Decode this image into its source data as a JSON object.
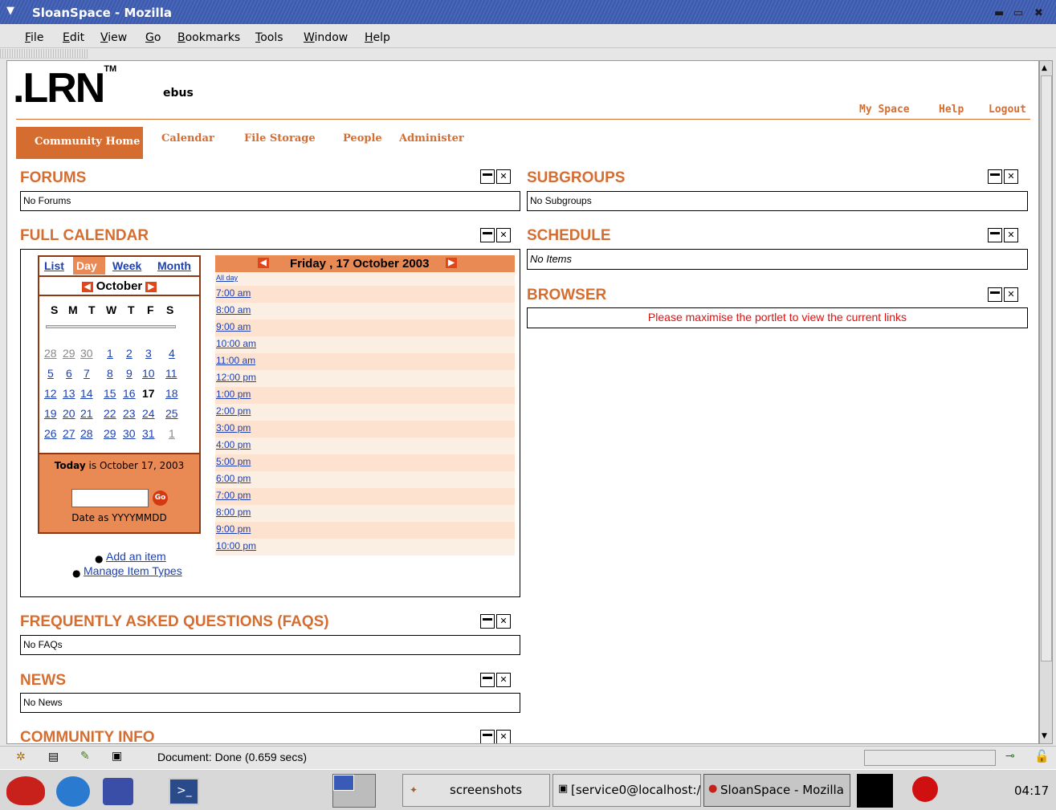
{
  "window": {
    "title": "SloanSpace - Mozilla"
  },
  "menu": [
    "File",
    "Edit",
    "View",
    "Go",
    "Bookmarks",
    "Tools",
    "Window",
    "Help"
  ],
  "header": {
    "logo": ".LRN",
    "tm": "TM",
    "community": "ebus",
    "links": [
      "My Space",
      "Help",
      "Logout"
    ]
  },
  "tabs": [
    "Community Home",
    "Calendar",
    "File Storage",
    "People",
    "Administer"
  ],
  "portlets": {
    "forums": {
      "title": "FORUMS",
      "body": "No Forums"
    },
    "subgroups": {
      "title": "SUBGROUPS",
      "body": "No Subgroups"
    },
    "full_calendar": {
      "title": "FULL CALENDAR"
    },
    "schedule": {
      "title": "SCHEDULE",
      "body": "No Items"
    },
    "browser": {
      "title": "BROWSER",
      "body": "Please maximise the portlet to view the current links"
    },
    "faqs": {
      "title": "FREQUENTLY ASKED QUESTIONS (FAQS)",
      "body": "No FAQs"
    },
    "news": {
      "title": "NEWS",
      "body": "No News"
    },
    "community_info": {
      "title": "COMMUNITY INFO"
    }
  },
  "calendar": {
    "views": [
      "List",
      "Day",
      "Week",
      "Month"
    ],
    "month": "October",
    "weekdays": [
      "S",
      "M",
      "T",
      "W",
      "T",
      "F",
      "S"
    ],
    "weeks": [
      [
        "28",
        "29",
        "30",
        "1",
        "2",
        "3",
        "4"
      ],
      [
        "5",
        "6",
        "7",
        "8",
        "9",
        "10",
        "11"
      ],
      [
        "12",
        "13",
        "14",
        "15",
        "16",
        "17",
        "18"
      ],
      [
        "19",
        "20",
        "21",
        "22",
        "23",
        "24",
        "25"
      ],
      [
        "26",
        "27",
        "28",
        "29",
        "30",
        "31",
        "1"
      ]
    ],
    "today_bold": "Today",
    "today_rest": " is October 17, 2003",
    "date_hint": "Date as YYYYMMDD",
    "go": "Go",
    "actions": [
      "Add an item",
      "Manage Item Types"
    ],
    "day_title": "Friday , 17 October 2003",
    "slots": [
      "All day",
      "7:00 am",
      "8:00 am",
      "9:00 am",
      "10:00 am",
      "11:00 am",
      "12:00 pm",
      "1:00 pm",
      "2:00 pm",
      "3:00 pm",
      "4:00 pm",
      "5:00 pm",
      "6:00 pm",
      "7:00 pm",
      "8:00 pm",
      "9:00 pm",
      "10:00 pm"
    ]
  },
  "status": {
    "text": "Document: Done (0.659 secs)"
  },
  "taskbar": {
    "items": [
      "screenshots",
      "[service0@localhost:/",
      "SloanSpace - Mozilla"
    ],
    "clock": "04:17"
  }
}
